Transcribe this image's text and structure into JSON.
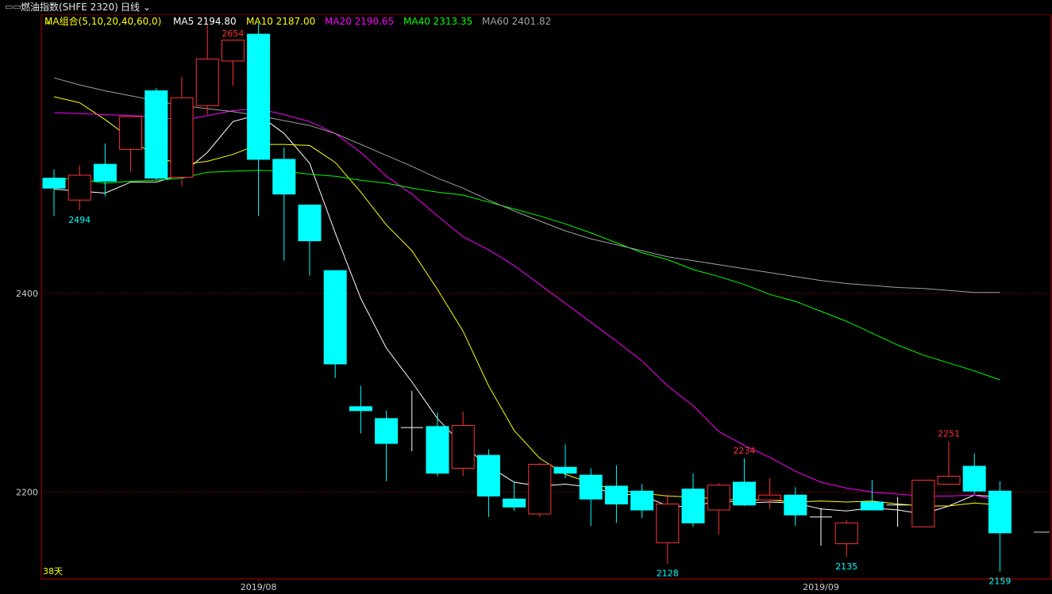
{
  "titlebar": {
    "window_icon": "restore-icon",
    "title": "燃油指数(SHFE 2320)",
    "period": "日线"
  },
  "ma_legend": {
    "group_label": "MA组合(5,10,20,40,60,0)",
    "items": [
      {
        "label": "MA5 2194.80",
        "color": "#ffffff"
      },
      {
        "label": "MA10 2187.00",
        "color": "#ffff00"
      },
      {
        "label": "MA20 2190.65",
        "color": "#ff00ff"
      },
      {
        "label": "MA40 2313.35",
        "color": "#00ff00"
      },
      {
        "label": "MA60 2401.82",
        "color": "#a0a0a0"
      }
    ]
  },
  "footer": {
    "days_label": "38天"
  },
  "chart_data": {
    "type": "candlestick",
    "y_axis": {
      "min": 2075,
      "max": 2720,
      "ticks": [
        2400,
        2200
      ]
    },
    "x_labels": [
      {
        "index": 8,
        "text": "2019/08"
      },
      {
        "index": 30,
        "text": "2019/09"
      }
    ],
    "colors": {
      "up": "#ff3232",
      "down": "#00ffff",
      "flat": "#ffffff",
      "frame": "#b40000"
    },
    "candles": [
      {
        "o": 2516,
        "h": 2525,
        "l": 2478,
        "c": 2506
      },
      {
        "o": 2494,
        "h": 2529,
        "l": 2484,
        "c": 2519
      },
      {
        "o": 2530,
        "h": 2551,
        "l": 2498,
        "c": 2513
      },
      {
        "o": 2545,
        "h": 2560,
        "l": 2522,
        "c": 2578
      },
      {
        "o": 2604,
        "h": 2607,
        "l": 2514,
        "c": 2516
      },
      {
        "o": 2517,
        "h": 2618,
        "l": 2508,
        "c": 2597
      },
      {
        "o": 2589,
        "h": 2670,
        "l": 2580,
        "c": 2636
      },
      {
        "o": 2634,
        "h": 2654,
        "l": 2609,
        "c": 2655
      },
      {
        "o": 2661,
        "h": 2672,
        "l": 2478,
        "c": 2535
      },
      {
        "o": 2535,
        "h": 2547,
        "l": 2433,
        "c": 2500
      },
      {
        "o": 2489,
        "h": 2489,
        "l": 2418,
        "c": 2453
      },
      {
        "o": 2423,
        "h": 2423,
        "l": 2315,
        "c": 2329
      },
      {
        "o": 2286,
        "h": 2307,
        "l": 2259,
        "c": 2282
      },
      {
        "o": 2274,
        "h": 2282,
        "l": 2211,
        "c": 2249
      },
      {
        "o": 2265,
        "h": 2302,
        "l": 2241,
        "c": 2265
      },
      {
        "o": 2266,
        "h": 2280,
        "l": 2216,
        "c": 2219
      },
      {
        "o": 2224,
        "h": 2281,
        "l": 2216,
        "c": 2267
      },
      {
        "o": 2237,
        "h": 2243,
        "l": 2175,
        "c": 2196
      },
      {
        "o": 2193,
        "h": 2211,
        "l": 2181,
        "c": 2185
      },
      {
        "o": 2178,
        "h": 2229,
        "l": 2175,
        "c": 2228
      },
      {
        "o": 2225,
        "h": 2248,
        "l": 2214,
        "c": 2219
      },
      {
        "o": 2217,
        "h": 2224,
        "l": 2166,
        "c": 2193
      },
      {
        "o": 2206,
        "h": 2227,
        "l": 2169,
        "c": 2188
      },
      {
        "o": 2201,
        "h": 2208,
        "l": 2174,
        "c": 2182
      },
      {
        "o": 2149,
        "h": 2198,
        "l": 2128,
        "c": 2188
      },
      {
        "o": 2203,
        "h": 2219,
        "l": 2165,
        "c": 2169
      },
      {
        "o": 2182,
        "h": 2209,
        "l": 2157,
        "c": 2207
      },
      {
        "o": 2210,
        "h": 2234,
        "l": 2186,
        "c": 2187
      },
      {
        "o": 2192,
        "h": 2214,
        "l": 2183,
        "c": 2197
      },
      {
        "o": 2197,
        "h": 2205,
        "l": 2166,
        "c": 2177
      },
      {
        "o": 2175,
        "h": 2184,
        "l": 2146,
        "c": 2175
      },
      {
        "o": 2148,
        "h": 2172,
        "l": 2135,
        "c": 2169
      },
      {
        "o": 2190,
        "h": 2212,
        "l": 2182,
        "c": 2182
      },
      {
        "o": 2187,
        "h": 2195,
        "l": 2165,
        "c": 2187
      },
      {
        "o": 2165,
        "h": 2212,
        "l": 2165,
        "c": 2212
      },
      {
        "o": 2208,
        "h": 2251,
        "l": 2207,
        "c": 2216
      },
      {
        "o": 2226,
        "h": 2239,
        "l": 2198,
        "c": 2201
      },
      {
        "o": 2201,
        "h": 2211,
        "l": 2120,
        "c": 2159
      }
    ],
    "annotations": [
      {
        "index": 7,
        "text": "2654",
        "at": "high",
        "color": "#ff3232"
      },
      {
        "index": 1,
        "text": "2494",
        "at": "low",
        "color": "#00ffff"
      },
      {
        "index": 24,
        "text": "2128",
        "at": "low",
        "color": "#00ffff"
      },
      {
        "index": 27,
        "text": "2234",
        "at": "high",
        "color": "#ff3232"
      },
      {
        "index": 31,
        "text": "2135",
        "at": "low",
        "color": "#00ffff"
      },
      {
        "index": 35,
        "text": "2251",
        "at": "high",
        "color": "#ff3232"
      },
      {
        "index": 37,
        "text": "2159",
        "at": "low",
        "color": "#00ffff"
      }
    ],
    "ma_series": [
      {
        "name": "MA5",
        "color": "#ffffff",
        "values": [
          2505,
          2503,
          2501,
          2512,
          2512,
          2520,
          2542,
          2573,
          2580,
          2561,
          2531,
          2461,
          2395,
          2345,
          2311,
          2274,
          2247,
          2226,
          2210,
          2206,
          2208,
          2205,
          2198,
          2197,
          2186,
          2185,
          2192,
          2189,
          2190,
          2189,
          2183,
          2181,
          2184,
          2182,
          2178,
          2186,
          2197,
          2195
        ]
      },
      {
        "name": "MA10",
        "color": "#ffff00",
        "values": [
          2598,
          2592,
          2575,
          2556,
          2537,
          2530,
          2533,
          2540,
          2550,
          2550,
          2549,
          2532,
          2502,
          2469,
          2443,
          2404,
          2362,
          2307,
          2262,
          2234,
          2218,
          2209,
          2202,
          2199,
          2196,
          2195,
          2193,
          2192,
          2192,
          2190,
          2191,
          2190,
          2191,
          2188,
          2186,
          2186,
          2189,
          2187
        ]
      },
      {
        "name": "MA20",
        "color": "#ff00ff",
        "values": [
          2582,
          2581,
          2580,
          2579,
          2578,
          2574,
          2579,
          2584,
          2586,
          2580,
          2573,
          2561,
          2542,
          2518,
          2500,
          2478,
          2457,
          2444,
          2428,
          2409,
          2390,
          2371,
          2352,
          2332,
          2307,
          2287,
          2261,
          2247,
          2235,
          2221,
          2210,
          2204,
          2200,
          2198,
          2196,
          2196,
          2197,
          2191
        ]
      },
      {
        "name": "MA40",
        "color": "#00ff00",
        "vstart": 0,
        "values": [
          2516,
          2515,
          2511,
          2513,
          2514,
          2516,
          2522,
          2523,
          2524,
          2523,
          2520,
          2518,
          2514,
          2511,
          2506,
          2502,
          2499,
          2492,
          2485,
          2478,
          2470,
          2461,
          2451,
          2441,
          2434,
          2424,
          2417,
          2409,
          2399,
          2392,
          2382,
          2372,
          2360,
          2348,
          2338,
          2330,
          2322,
          2313
        ]
      },
      {
        "name": "MA60",
        "color": "#a0a0a0",
        "values": [
          2617,
          2610,
          2604,
          2599,
          2594,
          2589,
          2586,
          2583,
          2579,
          2574,
          2569,
          2561,
          2550,
          2539,
          2528,
          2516,
          2506,
          2494,
          2483,
          2473,
          2463,
          2455,
          2449,
          2443,
          2437,
          2433,
          2429,
          2425,
          2421,
          2417,
          2413,
          2410,
          2408,
          2406,
          2405,
          2403,
          2401,
          2401
        ]
      }
    ]
  }
}
